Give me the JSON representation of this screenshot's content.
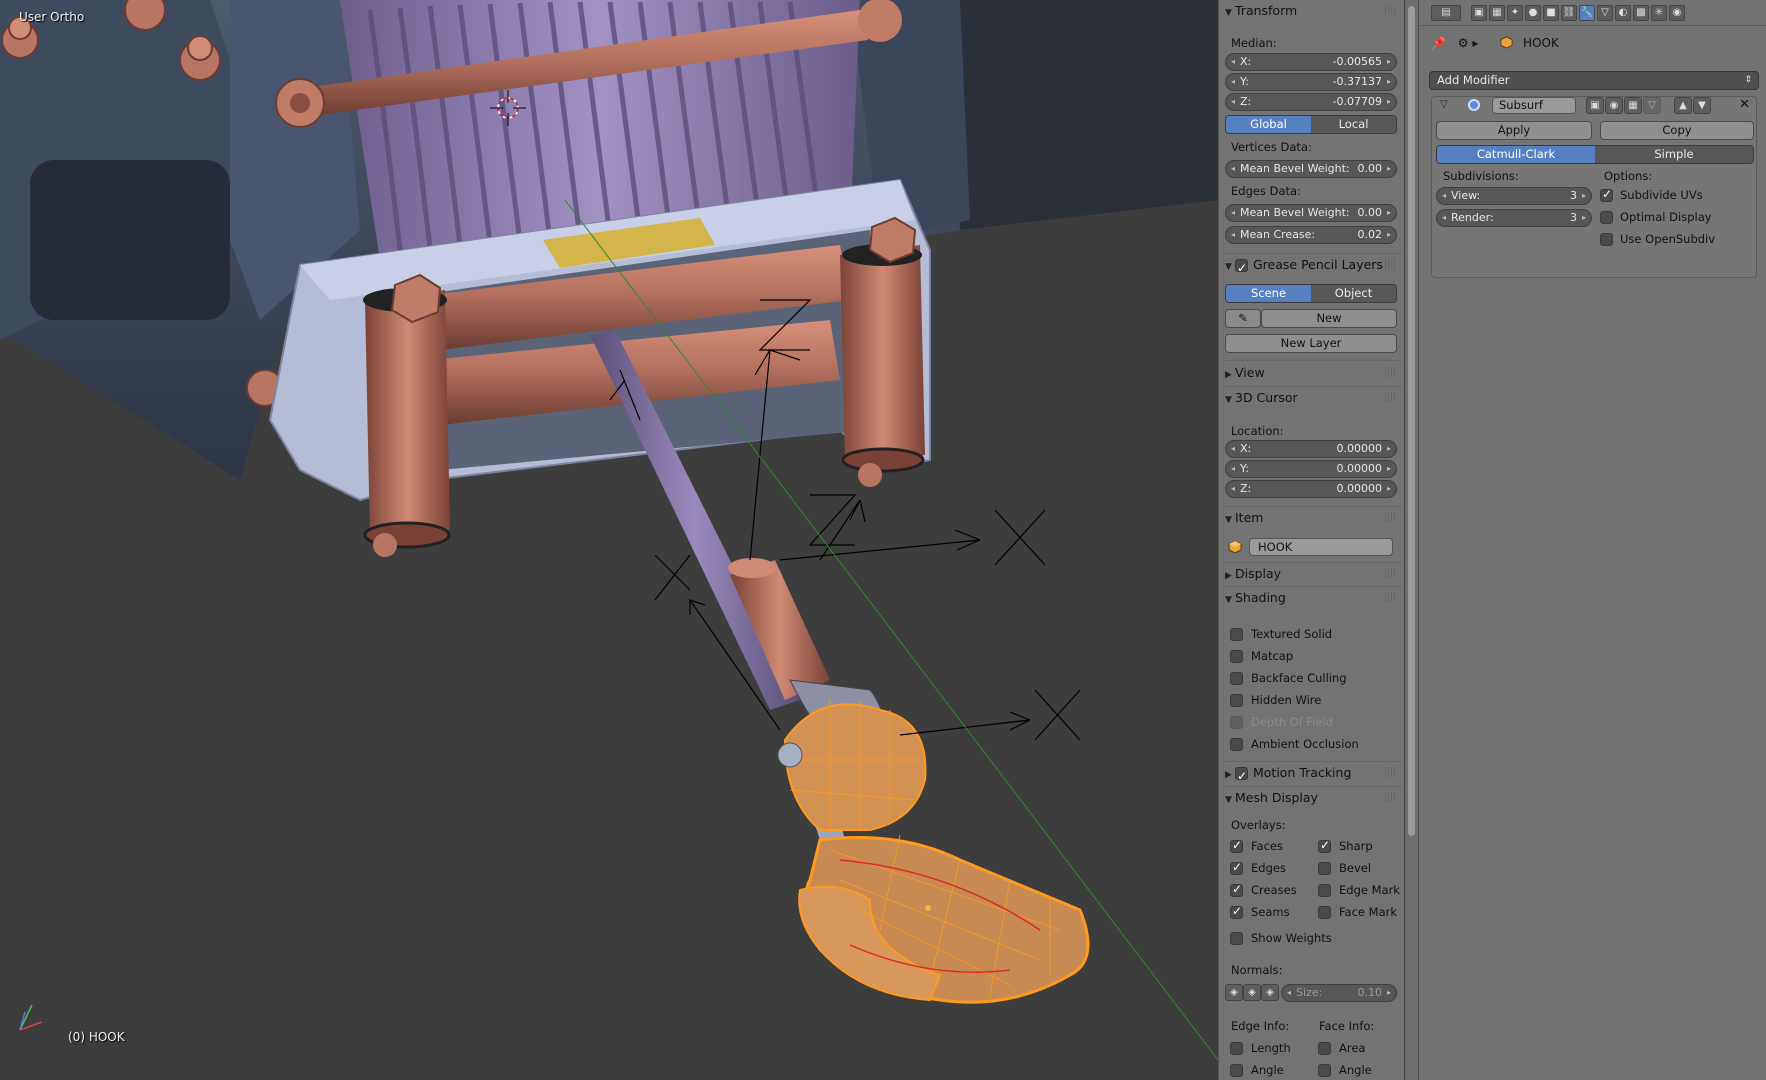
{
  "viewport": {
    "view_label": "User Ortho",
    "object_label": "(0) HOOK"
  },
  "npanel": {
    "transform": {
      "title": "Transform",
      "median_label": "Median:",
      "x_label": "X:",
      "x_value": "-0.00565",
      "y_label": "Y:",
      "y_value": "-0.37137",
      "z_label": "Z:",
      "z_value": "-0.07709",
      "global": "Global",
      "local": "Local",
      "vertices_data": "Vertices Data:",
      "v_bevel_label": "Mean Bevel Weight:",
      "v_bevel_value": "0.00",
      "edges_data": "Edges Data:",
      "e_bevel_label": "Mean Bevel Weight:",
      "e_bevel_value": "0.00",
      "crease_label": "Mean Crease:",
      "crease_value": "0.02"
    },
    "grease_pencil": {
      "title": "Grease Pencil Layers",
      "scene": "Scene",
      "object": "Object",
      "new": "New",
      "new_layer": "New Layer"
    },
    "view": {
      "title": "View"
    },
    "cursor": {
      "title": "3D Cursor",
      "location_label": "Location:",
      "x_label": "X:",
      "x_value": "0.00000",
      "y_label": "Y:",
      "y_value": "0.00000",
      "z_label": "Z:",
      "z_value": "0.00000"
    },
    "item": {
      "title": "Item",
      "name": "HOOK"
    },
    "display": {
      "title": "Display"
    },
    "shading": {
      "title": "Shading",
      "textured_solid": "Textured Solid",
      "matcap": "Matcap",
      "backface_culling": "Backface Culling",
      "hidden_wire": "Hidden Wire",
      "depth_of_field": "Depth Of Field",
      "ambient_occlusion": "Ambient Occlusion"
    },
    "motion_tracking": {
      "title": "Motion Tracking"
    },
    "mesh_display": {
      "title": "Mesh Display",
      "overlays_label": "Overlays:",
      "faces": "Faces",
      "sharp": "Sharp",
      "edges": "Edges",
      "bevel": "Bevel",
      "creases": "Creases",
      "edge_mark": "Edge Mark",
      "seams": "Seams",
      "face_mark": "Face Mark",
      "show_weights": "Show Weights",
      "normals_label": "Normals:",
      "size_label": "Size:",
      "size_value": "0.10",
      "edge_info": "Edge Info:",
      "face_info": "Face Info:",
      "length": "Length",
      "area": "Area",
      "angle_e": "Angle",
      "angle_f": "Angle"
    }
  },
  "props": {
    "breadcrumb_object": "HOOK",
    "add_modifier": "Add Modifier",
    "modifier": {
      "name": "Subsurf",
      "apply": "Apply",
      "copy": "Copy",
      "catmull": "Catmull-Clark",
      "simple": "Simple",
      "subdivisions_label": "Subdivisions:",
      "view_label": "View:",
      "view_value": "3",
      "render_label": "Render:",
      "render_value": "3",
      "options_label": "Options:",
      "subdivide_uvs": "Subdivide UVs",
      "optimal_display": "Optimal Display",
      "use_opensubdiv": "Use OpenSubdiv"
    }
  },
  "colors": {
    "selection_orange": "#ff9a1f",
    "active_blue": "#5680c2",
    "copper": "#b06e5c",
    "drum_purple": "#8a7aa8"
  }
}
